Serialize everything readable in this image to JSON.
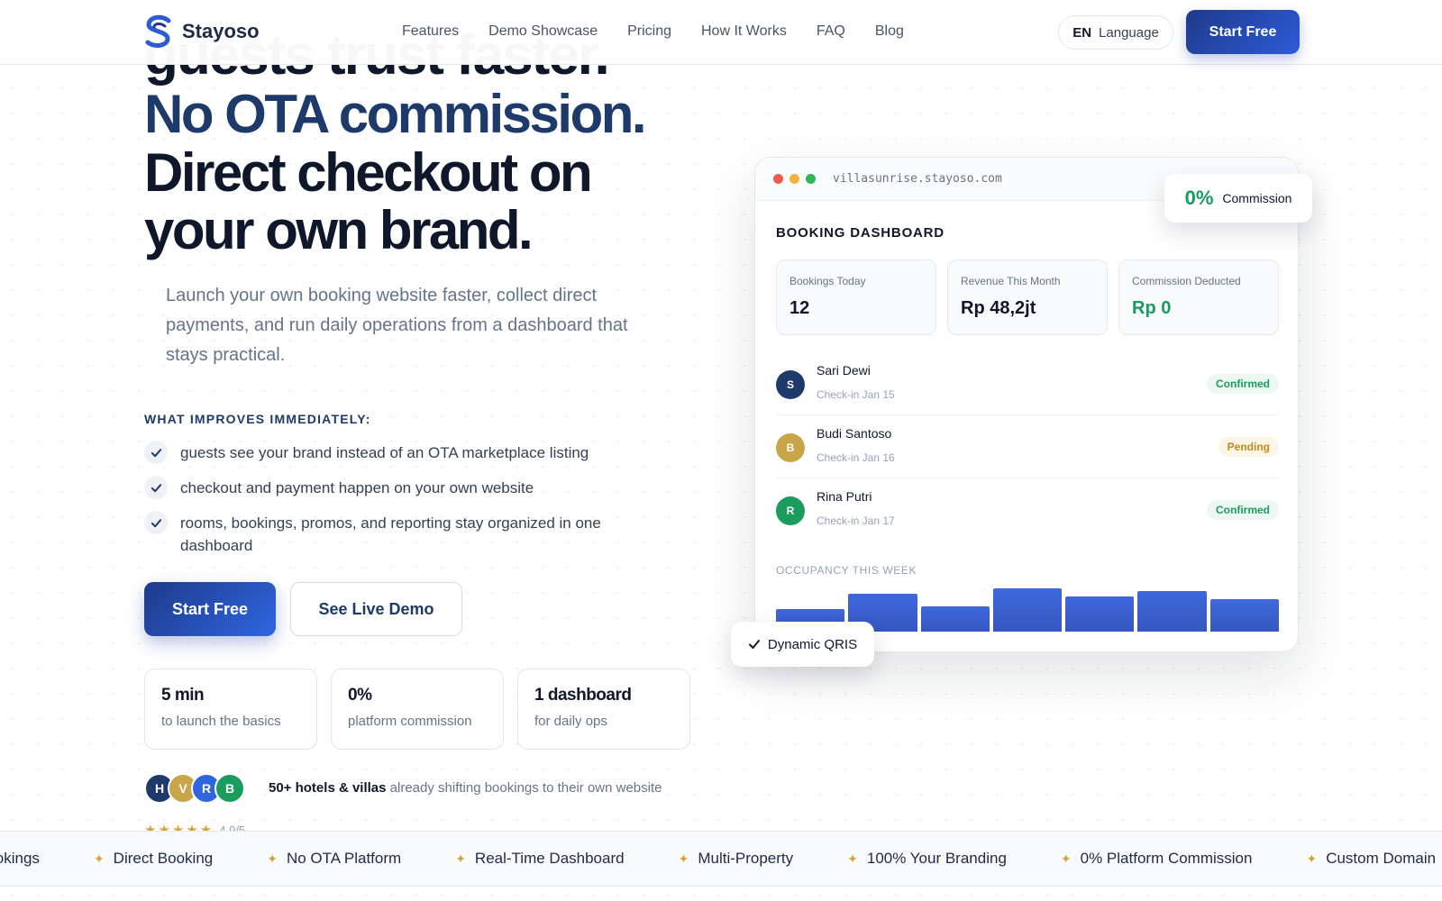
{
  "nav": {
    "brand": "Stayoso",
    "links": [
      "Features",
      "Demo Showcase",
      "Pricing",
      "How It Works",
      "FAQ",
      "Blog"
    ],
    "lang_code": "EN",
    "lang_label": "Language",
    "cta": "Start Free",
    "brand_color": "#1e3a8a"
  },
  "hero": {
    "clipped_line": "guests trust faster.",
    "line1": "No OTA commission.",
    "line2": "Direct checkout on",
    "line3": "your own brand.",
    "subtitle": "Launch your own booking website faster, collect direct payments, and run daily operations from a dashboard that stays practical.",
    "improve_title": "WHAT IMPROVES IMMEDIATELY:",
    "improvements": [
      "guests see your brand instead of an OTA marketplace listing",
      "checkout and payment happen on your own website",
      "rooms, bookings, promos, and reporting stay organized in one dashboard"
    ],
    "cta_primary": "Start Free",
    "cta_secondary": "See Live Demo",
    "stats": [
      {
        "value": "5 min",
        "label": "to launch the basics"
      },
      {
        "value": "0%",
        "label": "platform commission"
      },
      {
        "value": "1 dashboard",
        "label": "for daily ops"
      }
    ],
    "avatars": [
      {
        "letter": "H",
        "color": "#1e3a6b"
      },
      {
        "letter": "V",
        "color": "#c9a54a"
      },
      {
        "letter": "R",
        "color": "#2f66e0"
      },
      {
        "letter": "B",
        "color": "#1a9d5c"
      }
    ],
    "social_bold": "50+ hotels & villas",
    "social_rest": " already shifting bookings to their own website",
    "stars": "★★★★★",
    "rating": "4.9/5"
  },
  "dashboard": {
    "url": "villasunrise.stayoso.com",
    "title": "BOOKING DASHBOARD",
    "metrics": [
      {
        "label": "Bookings Today",
        "value": "12"
      },
      {
        "label": "Revenue This Month",
        "value": "Rp 48,2jt"
      },
      {
        "label": "Commission Deducted",
        "value": "Rp 0"
      }
    ],
    "bookings": [
      {
        "initial": "S",
        "name": "Sari Dewi",
        "checkin": "Check-in Jan 15",
        "status": "Confirmed",
        "color": "#1e3a6b"
      },
      {
        "initial": "B",
        "name": "Budi Santoso",
        "checkin": "Check-in Jan 16",
        "status": "Pending",
        "color": "#c9a54a"
      },
      {
        "initial": "R",
        "name": "Rina Putri",
        "checkin": "Check-in Jan 17",
        "status": "Confirmed",
        "color": "#1a9d5c"
      }
    ],
    "occupancy_title": "OCCUPANCY THIS WEEK",
    "occupancy": [
      0.45,
      0.75,
      0.5,
      0.85,
      0.7,
      0.8,
      0.65
    ],
    "commission_pill": {
      "value": "0%",
      "label": "Commission"
    },
    "qris_pill": "Dynamic QRIS"
  },
  "marquee": [
    "Bookings",
    "Direct Booking",
    "No OTA Platform",
    "Real-Time Dashboard",
    "Multi-Property",
    "100% Your Branding",
    "0% Platform Commission",
    "Custom Domain"
  ]
}
